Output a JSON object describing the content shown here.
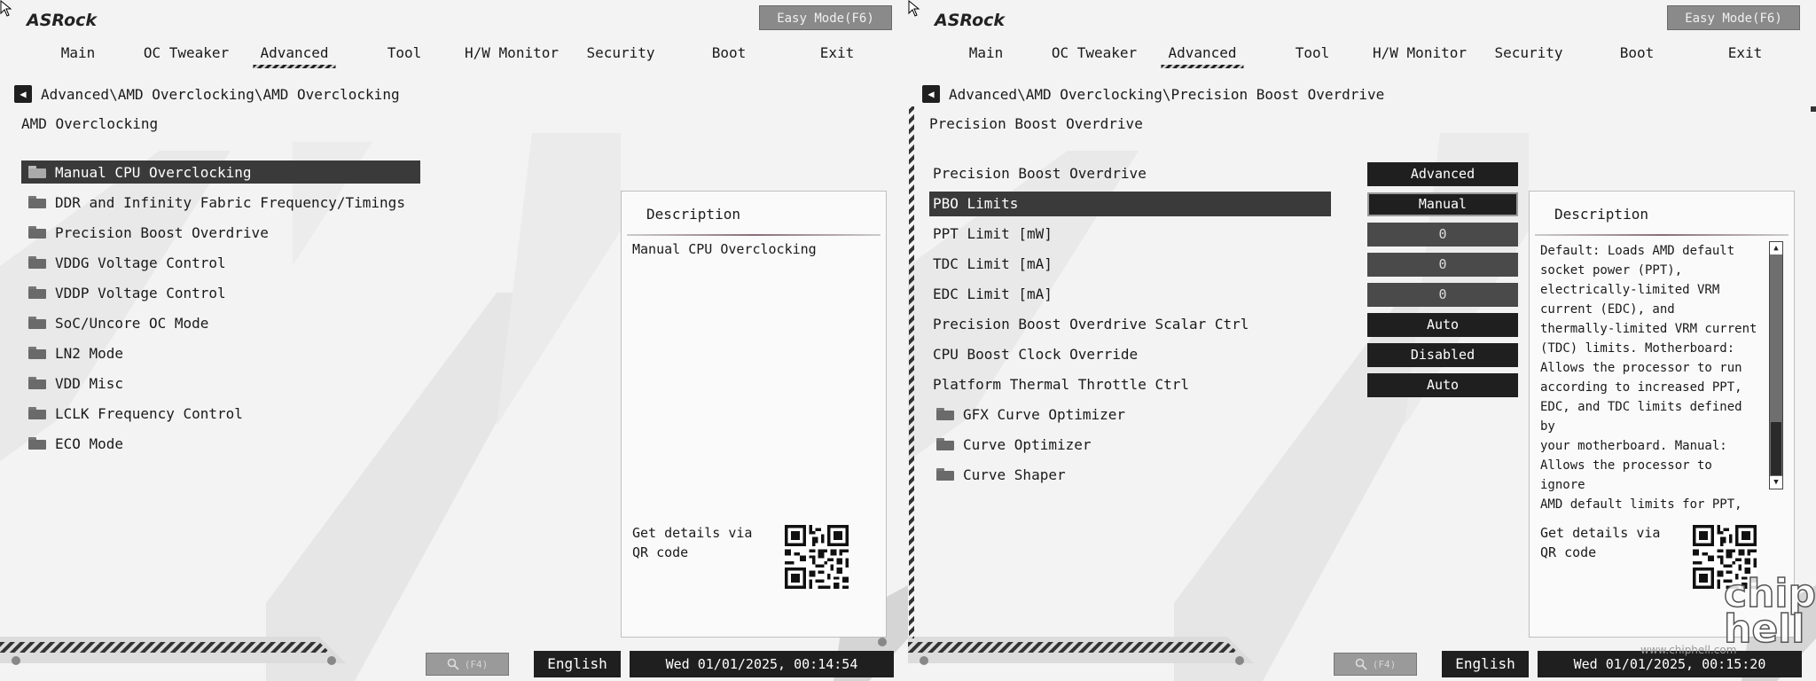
{
  "brand": "ASRock",
  "easy_mode_label": "Easy Mode(F6)",
  "tabs": [
    "Main",
    "OC Tweaker",
    "Advanced",
    "Tool",
    "H/W Monitor",
    "Security",
    "Boot",
    "Exit"
  ],
  "active_tab": "Advanced",
  "left": {
    "breadcrumb": "Advanced\\AMD Overclocking\\AMD Overclocking",
    "section_title": "AMD Overclocking",
    "menu": [
      {
        "label": "Manual CPU Overclocking",
        "selected": true
      },
      {
        "label": "DDR and Infinity Fabric Frequency/Timings"
      },
      {
        "label": "Precision Boost Overdrive"
      },
      {
        "label": "VDDG Voltage Control"
      },
      {
        "label": "VDDP Voltage Control"
      },
      {
        "label": "SoC/Uncore OC Mode"
      },
      {
        "label": "LN2 Mode"
      },
      {
        "label": "VDD Misc"
      },
      {
        "label": "LCLK Frequency Control"
      },
      {
        "label": "ECO Mode"
      }
    ],
    "description": {
      "title": "Description",
      "text": "Manual CPU Overclocking",
      "qr_text": "Get details via QR code"
    },
    "search_label": "(F4)",
    "language": "English",
    "datetime": "Wed 01/01/2025, 00:14:54"
  },
  "right": {
    "breadcrumb": "Advanced\\AMD Overclocking\\Precision Boost Overdrive",
    "section_title": "Precision Boost Overdrive",
    "settings": [
      {
        "label": "Precision Boost Overdrive",
        "value": "Advanced"
      },
      {
        "label": "PBO Limits",
        "value": "Manual",
        "selected": true
      },
      {
        "label": "PPT Limit [mW]",
        "value": "0",
        "numeric": true
      },
      {
        "label": "TDC Limit [mA]",
        "value": "0",
        "numeric": true
      },
      {
        "label": "EDC Limit [mA]",
        "value": "0",
        "numeric": true
      },
      {
        "label": "Precision Boost Overdrive Scalar Ctrl",
        "value": "Auto"
      },
      {
        "label": "CPU Boost Clock Override",
        "value": "Disabled"
      },
      {
        "label": "Platform Thermal Throttle Ctrl",
        "value": "Auto"
      }
    ],
    "submenus": [
      "GFX Curve Optimizer",
      "Curve Optimizer",
      "Curve Shaper"
    ],
    "description": {
      "title": "Description",
      "text": "Default: Loads AMD default\nsocket power (PPT),\nelectrically-limited VRM\ncurrent (EDC), and\nthermally-limited VRM current\n(TDC) limits. Motherboard:\nAllows the processor to run\naccording to increased PPT,\nEDC, and TDC limits defined by\nyour motherboard. Manual:\nAllows the processor to ignore\nAMD default limits for PPT,",
      "qr_text": "Get details via QR code"
    },
    "search_label": "(F4)",
    "language": "English",
    "datetime": "Wed 01/01/2025, 00:15:20"
  },
  "watermark": {
    "text": "chip\nhell",
    "url": "www.chiphell.com"
  },
  "colors": {
    "dark": "#1f1f1f",
    "selected": "#3a3a3a",
    "panel": "#f3f3f3"
  }
}
